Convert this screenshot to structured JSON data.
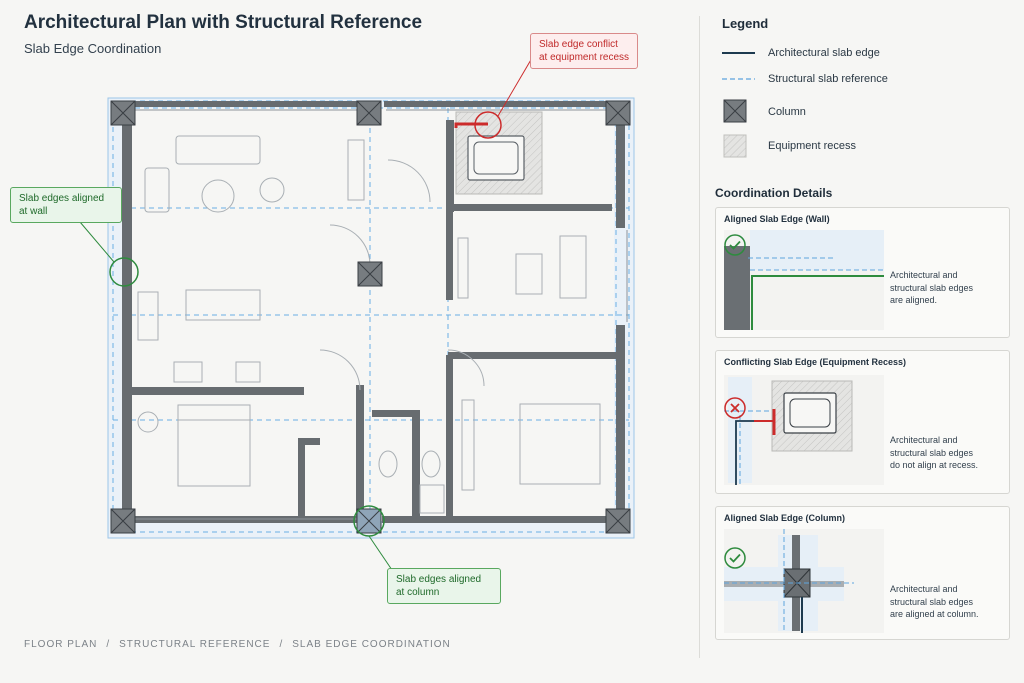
{
  "header": {
    "title": "Architectural Plan with Structural Reference",
    "subtitle": "Slab Edge Coordination"
  },
  "breadcrumb": [
    "FLOOR PLAN",
    "STRUCTURAL REFERENCE",
    "SLAB EDGE COORDINATION"
  ],
  "breadcrumb_separator": "/",
  "callouts": {
    "conflict": [
      "Slab edge conflict",
      "at equipment recess"
    ],
    "wall": [
      "Slab edges aligned",
      "at wall"
    ],
    "column": [
      "Slab edges aligned",
      "at column"
    ]
  },
  "legend": {
    "title": "Legend",
    "items": [
      {
        "label": "Architectural slab edge",
        "icon": "solid-line-icon"
      },
      {
        "label": "Structural slab reference",
        "icon": "dashed-line-icon"
      },
      {
        "label": "Column",
        "icon": "column-icon"
      },
      {
        "label": "Equipment recess",
        "icon": "hatch-icon"
      }
    ]
  },
  "coordination": {
    "title": "Coordination Details",
    "cards": [
      {
        "title": "Aligned Slab Edge (Wall)",
        "status": "check-icon",
        "text": [
          "Architectural and",
          "structural slab edges",
          "are aligned."
        ]
      },
      {
        "title": "Conflicting Slab Edge (Equipment Recess)",
        "status": "cross-icon",
        "text": [
          "Architectural and",
          "structural slab edges",
          "do not align at recess."
        ]
      },
      {
        "title": "Aligned Slab Edge (Column)",
        "status": "check-icon",
        "text": [
          "Architectural and",
          "structural slab edges",
          "are aligned at column."
        ]
      }
    ]
  },
  "colors": {
    "architectural_edge": "#1d3a4f",
    "structural_reference": "#5da4de",
    "wall": "#676c70",
    "aligned": "#2e8b3e",
    "conflict": "#cc2b2b",
    "background": "#f6f6f4"
  }
}
